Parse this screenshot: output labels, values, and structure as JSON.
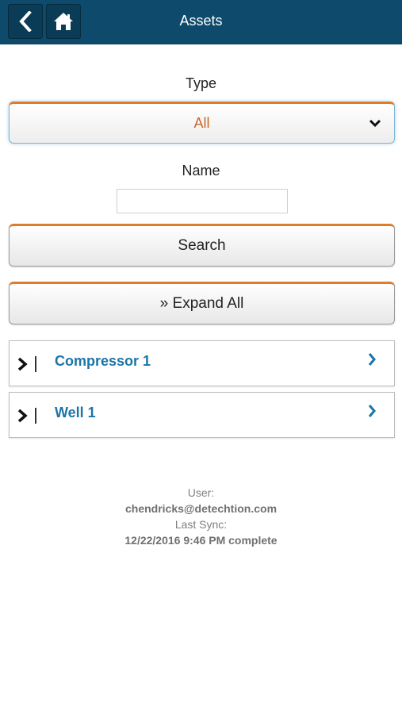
{
  "header": {
    "title": "Assets",
    "back_icon": "chevron-left-icon",
    "home_icon": "home-icon"
  },
  "form": {
    "type_label": "Type",
    "type_value": "All",
    "name_label": "Name",
    "name_value": "",
    "name_placeholder": ""
  },
  "buttons": {
    "search_label": "Search",
    "expand_all_label": "» Expand All"
  },
  "assets": [
    {
      "label": "Compressor 1"
    },
    {
      "label": "Well 1"
    }
  ],
  "footer": {
    "user_label": "User:",
    "user_value": "chendricks@detechtion.com",
    "last_sync_label": "Last Sync:",
    "last_sync_value": "12/22/2016 9:46 PM complete"
  },
  "colors": {
    "header_bg": "#0d4a6b",
    "accent_orange": "#e07b2a",
    "link_blue": "#1a75a8"
  }
}
